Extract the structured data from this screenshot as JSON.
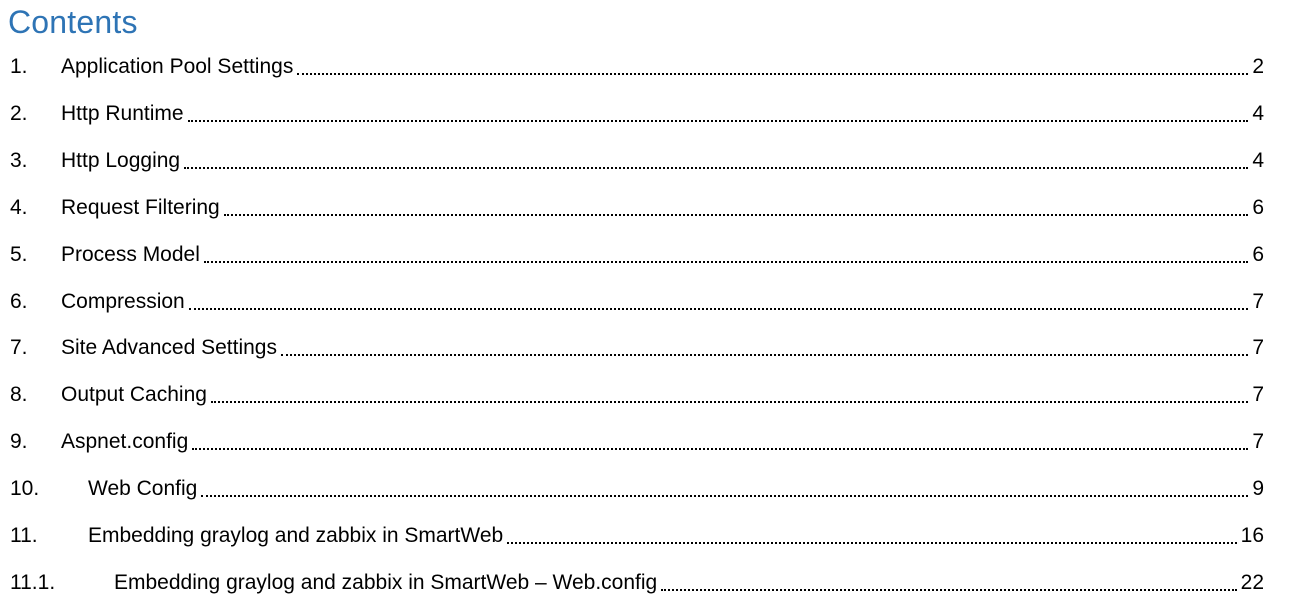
{
  "document": {
    "title": "Contents",
    "title_color": "#2E74B5",
    "text_color": "#000000",
    "entries": [
      {
        "number": "1.",
        "label": "Application Pool Settings",
        "page": "2",
        "level": 1
      },
      {
        "number": "2.",
        "label": "Http Runtime",
        "page": "4",
        "level": 1
      },
      {
        "number": "3.",
        "label": "Http Logging",
        "page": "4",
        "level": 1
      },
      {
        "number": "4.",
        "label": "Request Filtering",
        "page": "6",
        "level": 1
      },
      {
        "number": "5.",
        "label": "Process Model",
        "page": "6",
        "level": 1
      },
      {
        "number": "6.",
        "label": "Compression",
        "page": "7",
        "level": 1
      },
      {
        "number": "7.",
        "label": "Site Advanced Settings",
        "page": "7",
        "level": 1
      },
      {
        "number": "8.",
        "label": "Output Caching",
        "page": "7",
        "level": 1
      },
      {
        "number": "9.",
        "label": "Aspnet.config",
        "page": "7",
        "level": 1
      },
      {
        "number": "10.",
        "label": "Web Config",
        "page": "9",
        "level": 1
      },
      {
        "number": "11.",
        "label": "Embedding graylog and zabbix in SmartWeb",
        "page": "16",
        "level": 1
      },
      {
        "number": "11.1.",
        "label": "Embedding graylog and zabbix in SmartWeb – Web.config",
        "page": "22",
        "level": 2
      }
    ]
  }
}
